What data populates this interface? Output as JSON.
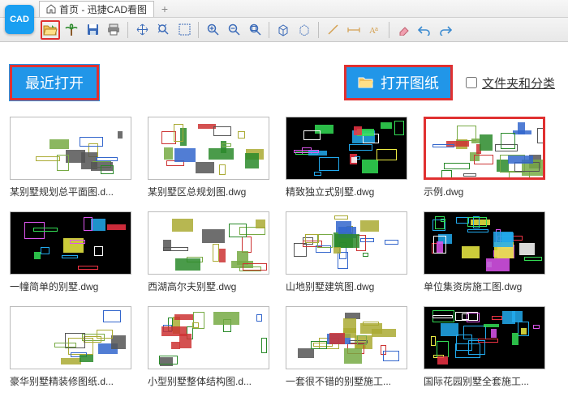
{
  "app": {
    "icon_text": "CAD"
  },
  "tabs": {
    "home": "首页 - 迅捷CAD看图",
    "add": "+"
  },
  "header": {
    "recent": "最近打开",
    "open": "打开图纸",
    "folder_label": "文件夹和分类"
  },
  "files": [
    {
      "name": "某别墅规划总平面图.d...",
      "bg": "light",
      "style": 0,
      "red": false
    },
    {
      "name": "某别墅区总规划图.dwg",
      "bg": "light",
      "style": 1,
      "red": false
    },
    {
      "name": "精致独立式别墅.dwg",
      "bg": "dark",
      "style": 2,
      "red": false
    },
    {
      "name": "示例.dwg",
      "bg": "light",
      "style": 3,
      "red": true
    },
    {
      "name": "一幢简单的别墅.dwg",
      "bg": "dark",
      "style": 4,
      "red": false
    },
    {
      "name": "西湖高尔夫别墅.dwg",
      "bg": "light",
      "style": 5,
      "red": false
    },
    {
      "name": "山地别墅建筑图.dwg",
      "bg": "light",
      "style": 6,
      "red": false
    },
    {
      "name": "单位集资房施工图.dwg",
      "bg": "dark",
      "style": 7,
      "red": false
    },
    {
      "name": "豪华别墅精装修图纸.d...",
      "bg": "light",
      "style": 8,
      "red": false
    },
    {
      "name": "小型别墅整体结构图.d...",
      "bg": "light",
      "style": 9,
      "red": false
    },
    {
      "name": "一套很不错的别墅施工...",
      "bg": "light",
      "style": 10,
      "red": false
    },
    {
      "name": "国际花园别墅全套施工...",
      "bg": "dark",
      "style": 11,
      "red": false
    }
  ]
}
